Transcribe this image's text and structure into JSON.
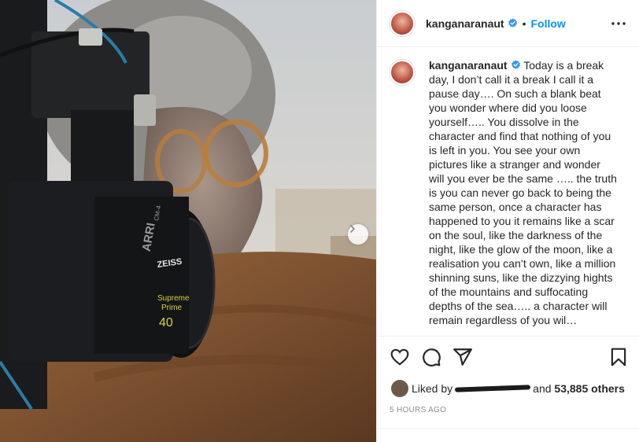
{
  "post": {
    "username": "kanganaranaut",
    "follow_label": "Follow",
    "separator": "•",
    "caption": "Today is a break day, I don’t call it a break I call it a pause day…. On such a blank beat you wonder where did you loose yourself….. You dissolve in the character and find that nothing of you is left in you. You see your own pictures like a stranger and wonder will you ever be the same ….. the truth is you can never go back to being the same person, once a character has happened to you it remains like a scar on the soul, like the darkness of the night, like the glow of the moon, like a realisation you can’t own, like a million shinning suns, like the dizzying hights of the mountains and suffocating depths of the sea….. a character will remain regardless of you wil…",
    "liked_by_prefix": "Liked by",
    "liked_by_and": "and",
    "likes_count": "53,885 others",
    "timestamp": "5 HOURS AGO"
  },
  "photo": {
    "lens_brand": "ZEISS",
    "lens_line1": "Supreme",
    "lens_line2": "Prime",
    "lens_focal": "40",
    "camera_brand": "ARRI",
    "camera_model": "CM-4"
  },
  "colors": {
    "accent": "#0095f6",
    "verified": "#3897f0"
  },
  "icons": [
    "heart-icon",
    "comment-icon",
    "share-icon",
    "bookmark-icon",
    "more-icon",
    "verified-icon",
    "chevron-right-icon"
  ]
}
